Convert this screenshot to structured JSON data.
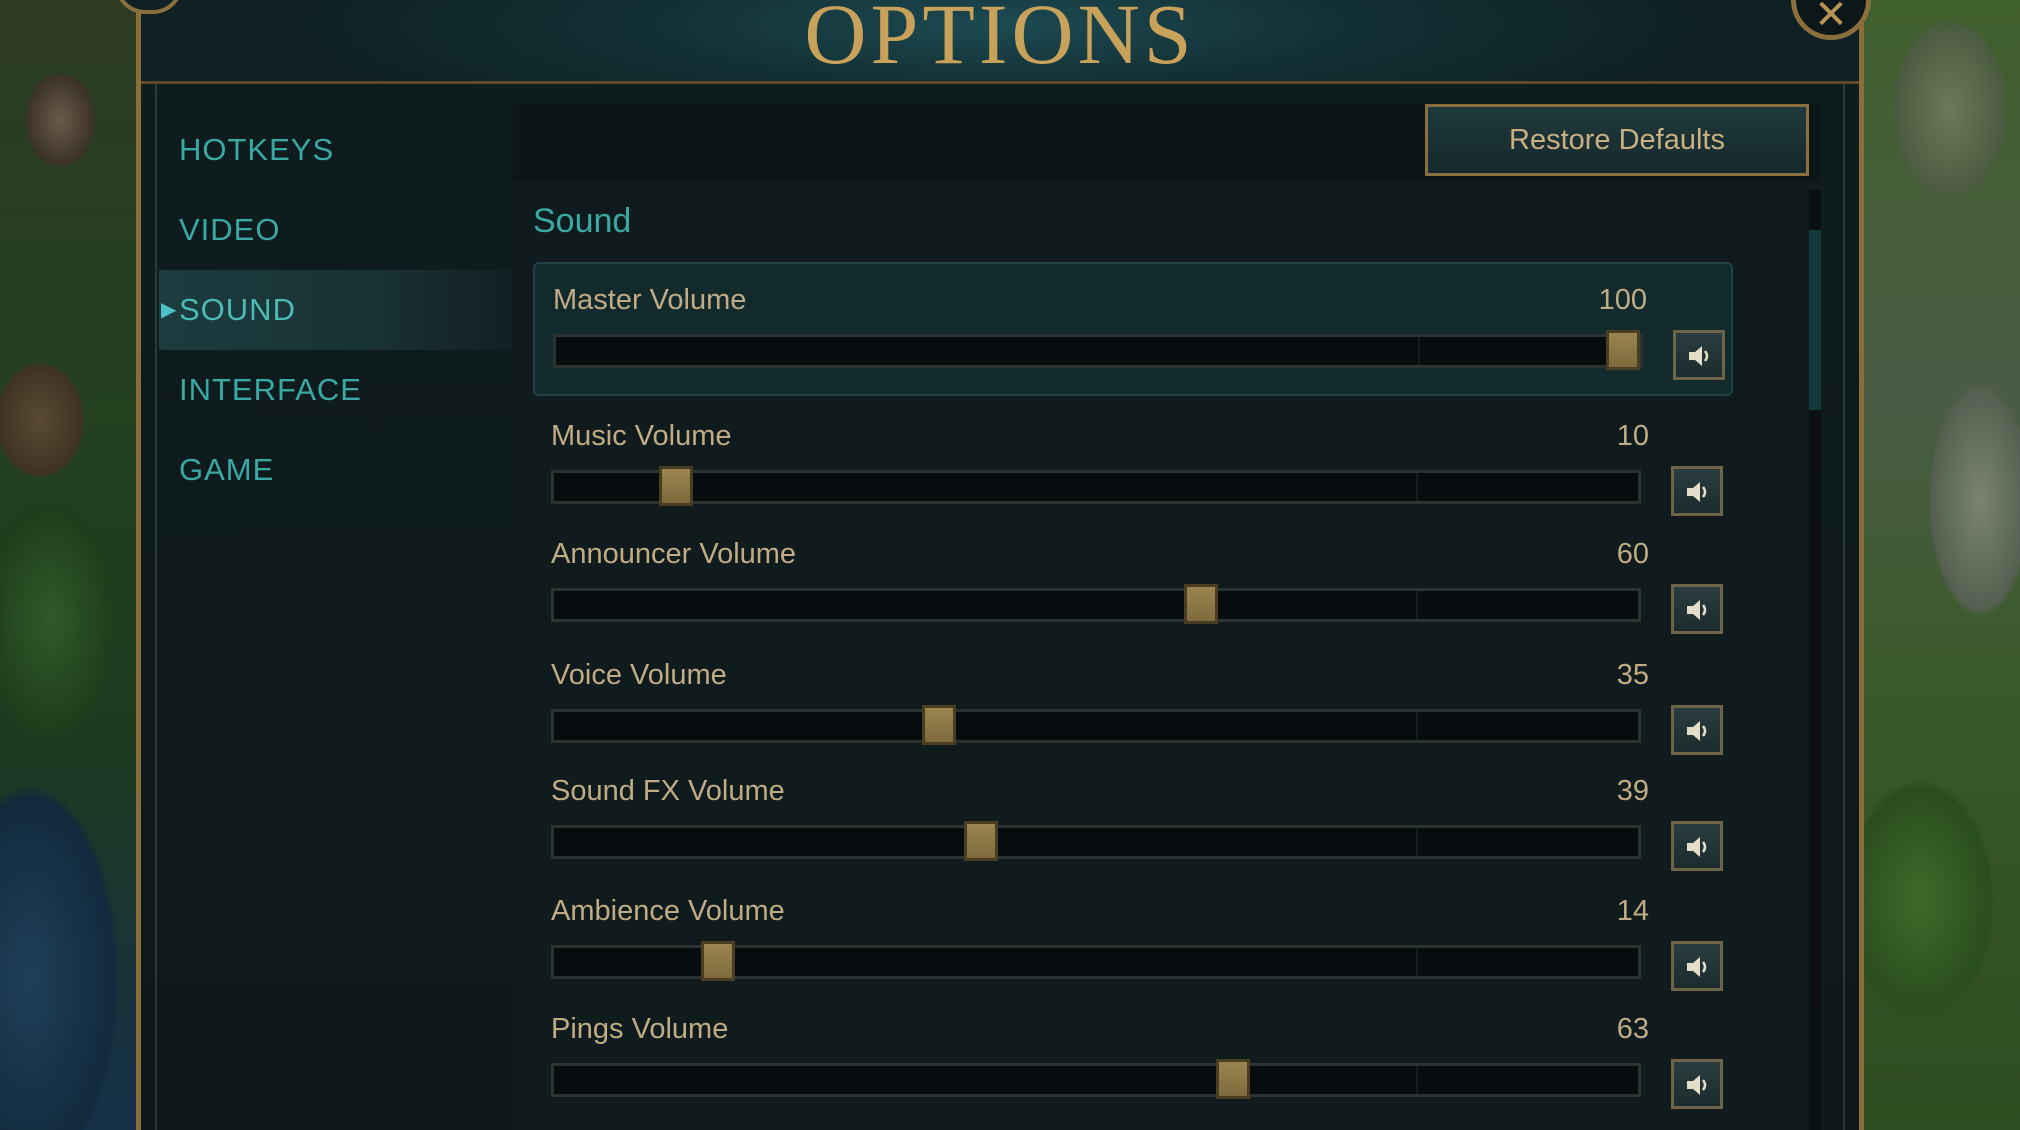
{
  "window": {
    "title": "OPTIONS",
    "close_icon": "close-icon"
  },
  "sidebar": {
    "items": [
      {
        "label": "HOTKEYS",
        "active": false
      },
      {
        "label": "VIDEO",
        "active": false
      },
      {
        "label": "SOUND",
        "active": true
      },
      {
        "label": "INTERFACE",
        "active": false
      },
      {
        "label": "GAME",
        "active": false
      }
    ]
  },
  "toolbar": {
    "restore_label": "Restore Defaults"
  },
  "sound": {
    "section_title": "Sound",
    "sliders": [
      {
        "label": "Master Volume",
        "value": "100",
        "level": 100
      },
      {
        "label": "Music Volume",
        "value": "10",
        "level": 10
      },
      {
        "label": "Announcer Volume",
        "value": "60",
        "level": 60
      },
      {
        "label": "Voice Volume",
        "value": "35",
        "level": 35
      },
      {
        "label": "Sound FX Volume",
        "value": "39",
        "level": 39
      },
      {
        "label": "Ambience Volume",
        "value": "14",
        "level": 14
      },
      {
        "label": "Pings Volume",
        "value": "63",
        "level": 63
      }
    ],
    "mute_icon": "speaker-icon"
  },
  "colors": {
    "accent_gold": "#c8a15a",
    "accent_teal": "#3aa8a3",
    "label_tan": "#c0ab84"
  }
}
